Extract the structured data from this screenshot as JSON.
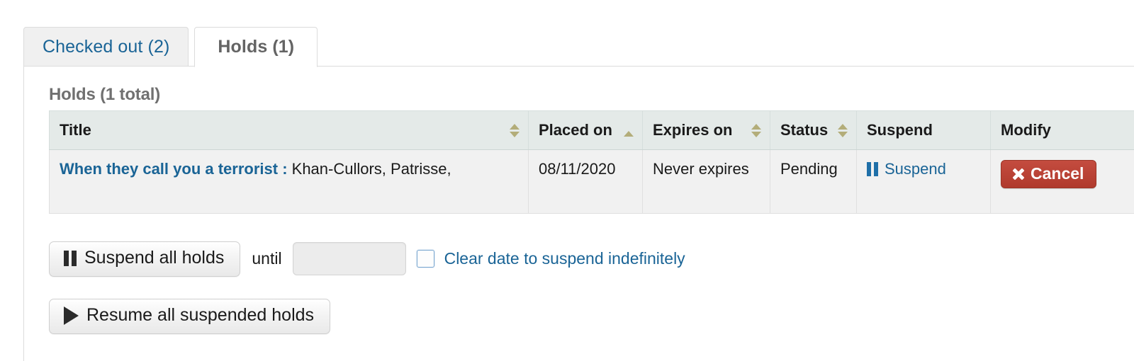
{
  "tabs": [
    {
      "label": "Checked out (2)",
      "active": false,
      "name": "tab-checked-out"
    },
    {
      "label": "Holds (1)",
      "active": true,
      "name": "tab-holds"
    }
  ],
  "panel": {
    "heading": "Holds (1 total)",
    "heading_strong": "Holds",
    "heading_rest": "(1 total)"
  },
  "table": {
    "columns": [
      {
        "label": "Title",
        "sortable": true,
        "sort": "none"
      },
      {
        "label": "Placed on",
        "sortable": true,
        "sort": "asc"
      },
      {
        "label": "Expires on",
        "sortable": true,
        "sort": "none"
      },
      {
        "label": "Status",
        "sortable": true,
        "sort": "none"
      },
      {
        "label": "Suspend",
        "sortable": false,
        "sort": "none"
      },
      {
        "label": "Modify",
        "sortable": false,
        "sort": "none"
      }
    ],
    "rows": [
      {
        "title": "When they call you a terrorist :",
        "author": "Khan-Cullors, Patrisse,",
        "placed_on": "08/11/2020",
        "expires_on": "Never expires",
        "status": "Pending",
        "suspend_label": "Suspend",
        "modify_label": "Cancel"
      }
    ]
  },
  "controls": {
    "suspend_all_label": "Suspend all holds",
    "until_label": "until",
    "date_value": "",
    "date_placeholder": "",
    "clear_date_label": "Clear date to suspend indefinitely",
    "resume_all_label": "Resume all suspended holds"
  },
  "colors": {
    "link": "#1a6496",
    "danger": "#b03a2d",
    "header_bg": "#e4eae8",
    "row_bg": "#f1f1f1",
    "sort_arrow": "#b3ad79",
    "calendar_orange": "#f2913d"
  }
}
